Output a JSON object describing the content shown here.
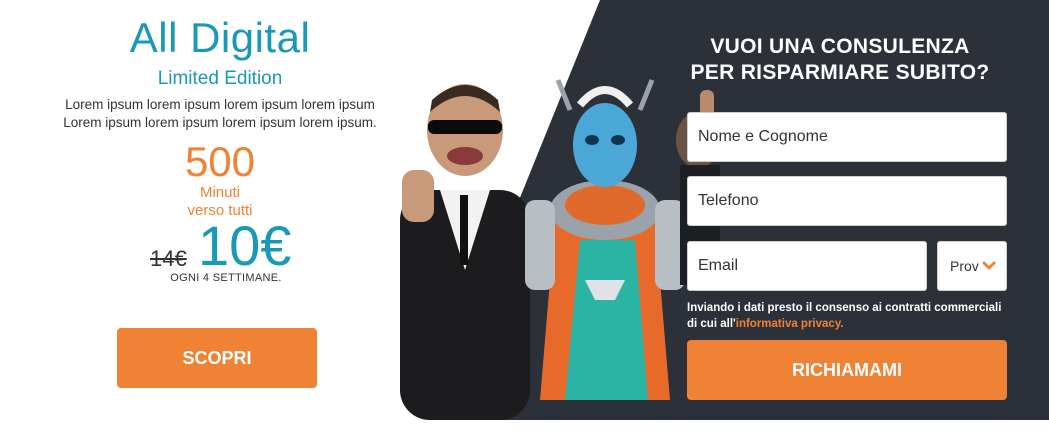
{
  "offer": {
    "title": "All Digital",
    "subtitle": "Limited Edition",
    "description_line1": "Lorem ipsum lorem ipsum lorem ipsum lorem ipsum",
    "description_line2": "Lorem ipsum lorem ipsum lorem ipsum lorem ipsum.",
    "minutes_number": "500",
    "minutes_label_line1": "Minuti",
    "minutes_label_line2": "verso tutti",
    "old_price": "14€",
    "new_price": "10€",
    "price_period": "OGNI 4 SETTIMANE.",
    "cta_label": "SCOPRI"
  },
  "form": {
    "headline_line1": "VUOI UNA CONSULENZA",
    "headline_line2": "PER RISPARMIARE SUBITO?",
    "name_placeholder": "Nome e Cognome",
    "phone_placeholder": "Telefono",
    "email_placeholder": "Email",
    "province_selected": "Prov",
    "consent_text": "Inviando i dati presto il consenso ai contratti commerciali di cui all'",
    "consent_link": "informativa privacy.",
    "submit_label": "RICHIAMAMI"
  },
  "icons": {
    "select_chevron": "chevron-down-icon"
  },
  "colors": {
    "accent_orange": "#f08236",
    "brand_blue": "#1a98b8",
    "panel_dark": "#2c3139"
  }
}
